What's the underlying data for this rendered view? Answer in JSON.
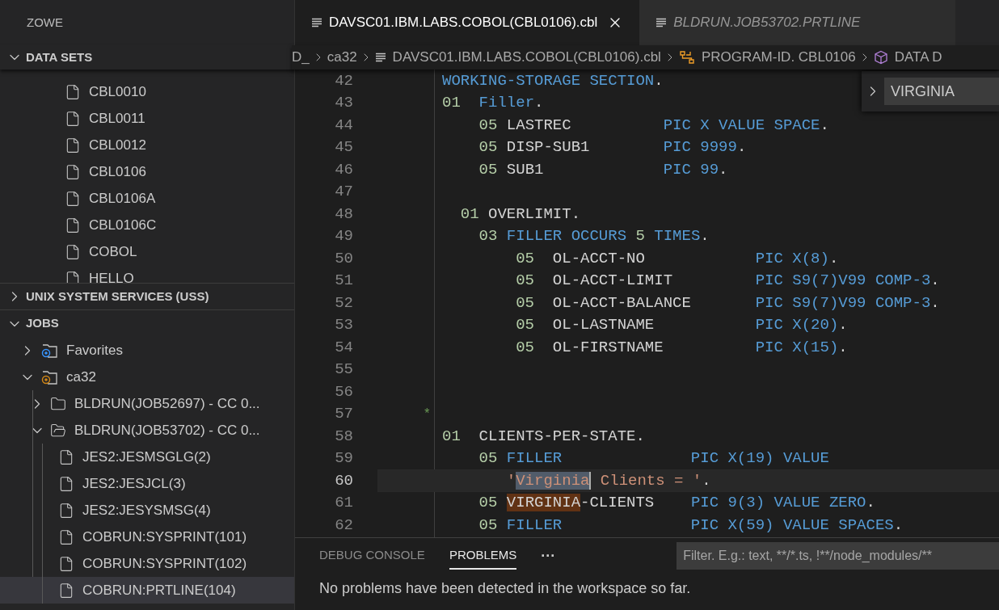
{
  "sidebar": {
    "title": "ZOWE",
    "data_sets": {
      "label": "DATA SETS",
      "expanded": true,
      "members": [
        {
          "label": "CBL0010",
          "selected": false
        },
        {
          "label": "CBL0011",
          "selected": false
        },
        {
          "label": "CBL0012",
          "selected": false
        },
        {
          "label": "CBL0106",
          "selected": false
        },
        {
          "label": "CBL0106A",
          "selected": false
        },
        {
          "label": "CBL0106C",
          "selected": false
        },
        {
          "label": "COBOL",
          "selected": false
        },
        {
          "label": "HELLO",
          "selected": false
        }
      ]
    },
    "uss": {
      "label": "UNIX SYSTEM SERVICES (USS)",
      "expanded": false
    },
    "jobs": {
      "label": "JOBS",
      "expanded": true,
      "items": [
        {
          "kind": "favorites",
          "label": "Favorites",
          "expanded": false,
          "selected": false
        },
        {
          "kind": "profile",
          "label": "ca32",
          "expanded": true,
          "selected": false,
          "children": [
            {
              "kind": "folder",
              "label": "BLDRUN(JOB52697) - CC 0...",
              "expanded": false,
              "selected": false
            },
            {
              "kind": "folder",
              "label": "BLDRUN(JOB53702) - CC 0...",
              "expanded": true,
              "selected": false,
              "children": [
                {
                  "kind": "file",
                  "label": "JES2:JESMSGLG(2)",
                  "selected": false
                },
                {
                  "kind": "file",
                  "label": "JES2:JESJCL(3)",
                  "selected": false
                },
                {
                  "kind": "file",
                  "label": "JES2:JESYSMSG(4)",
                  "selected": false
                },
                {
                  "kind": "file",
                  "label": "COBRUN:SYSPRINT(101)",
                  "selected": false
                },
                {
                  "kind": "file",
                  "label": "COBRUN:SYSPRINT(102)",
                  "selected": false
                },
                {
                  "kind": "file",
                  "label": "COBRUN:PRTLINE(104)",
                  "selected": true
                }
              ]
            }
          ]
        }
      ]
    }
  },
  "tabs": [
    {
      "label": "DAVSC01.IBM.LABS.COBOL(CBL0106).cbl",
      "selected": true,
      "preview": false
    },
    {
      "label": "BLDRUN.JOB53702.PRTLINE",
      "selected": false,
      "preview": true
    }
  ],
  "breadcrumb": [
    {
      "kind": "text",
      "label": "D_"
    },
    {
      "kind": "text",
      "label": "ca32"
    },
    {
      "kind": "file",
      "label": "DAVSC01.IBM.LABS.COBOL(CBL0106).cbl"
    },
    {
      "kind": "struct",
      "label": "PROGRAM-ID. CBL0106"
    },
    {
      "kind": "cube",
      "label": "DATA D"
    }
  ],
  "find_widget": {
    "expanded": false,
    "value": "VIRGINIA"
  },
  "code_lines": [
    {
      "number": "42",
      "current": false,
      "segments": [
        {
          "kind": "keyword",
          "text": "WORKING-STORAGE SECTION"
        },
        {
          "kind": "plain",
          "text": "."
        }
      ]
    },
    {
      "number": "43",
      "current": false,
      "segments": [
        {
          "kind": "number",
          "text": "01"
        },
        {
          "kind": "keyword",
          "text": "  Filler"
        },
        {
          "kind": "plain",
          "text": "."
        }
      ]
    },
    {
      "number": "44",
      "current": false,
      "segments": [
        {
          "kind": "number",
          "text": "    05"
        },
        {
          "kind": "plain",
          "text": " LASTREC          "
        },
        {
          "kind": "keyword",
          "text": "PIC X VALUE SPACE"
        },
        {
          "kind": "plain",
          "text": "."
        }
      ]
    },
    {
      "number": "45",
      "current": false,
      "segments": [
        {
          "kind": "number",
          "text": "    05"
        },
        {
          "kind": "plain",
          "text": " DISP-SUB1        "
        },
        {
          "kind": "keyword",
          "text": "PIC 9999"
        },
        {
          "kind": "plain",
          "text": "."
        }
      ]
    },
    {
      "number": "46",
      "current": false,
      "segments": [
        {
          "kind": "number",
          "text": "    05"
        },
        {
          "kind": "plain",
          "text": " SUB1             "
        },
        {
          "kind": "keyword",
          "text": "PIC 99"
        },
        {
          "kind": "plain",
          "text": "."
        }
      ]
    },
    {
      "number": "47",
      "current": false
    },
    {
      "number": "48",
      "current": false,
      "segments": [
        {
          "kind": "number",
          "text": "  01"
        },
        {
          "kind": "plain",
          "text": " OVERLIMIT."
        }
      ]
    },
    {
      "number": "49",
      "current": false,
      "segments": [
        {
          "kind": "number",
          "text": "    03"
        },
        {
          "kind": "keyword",
          "text": " FILLER OCCURS"
        },
        {
          "kind": "number",
          "text": " 5"
        },
        {
          "kind": "keyword",
          "text": " TIMES"
        },
        {
          "kind": "plain",
          "text": "."
        }
      ]
    },
    {
      "number": "50",
      "current": false,
      "segments": [
        {
          "kind": "number",
          "text": "        05"
        },
        {
          "kind": "plain",
          "text": "  OL-ACCT-NO            "
        },
        {
          "kind": "keyword",
          "text": "PIC X(8)"
        },
        {
          "kind": "plain",
          "text": "."
        }
      ]
    },
    {
      "number": "51",
      "current": false,
      "segments": [
        {
          "kind": "number",
          "text": "        05"
        },
        {
          "kind": "plain",
          "text": "  OL-ACCT-LIMIT         "
        },
        {
          "kind": "keyword",
          "text": "PIC S9(7)V99 COMP-3"
        },
        {
          "kind": "plain",
          "text": "."
        }
      ]
    },
    {
      "number": "52",
      "current": false,
      "segments": [
        {
          "kind": "number",
          "text": "        05"
        },
        {
          "kind": "plain",
          "text": "  OL-ACCT-BALANCE       "
        },
        {
          "kind": "keyword",
          "text": "PIC S9(7)V99 COMP-3"
        },
        {
          "kind": "plain",
          "text": "."
        }
      ]
    },
    {
      "number": "53",
      "current": false,
      "segments": [
        {
          "kind": "number",
          "text": "        05"
        },
        {
          "kind": "plain",
          "text": "  OL-LASTNAME           "
        },
        {
          "kind": "keyword",
          "text": "PIC X(20)"
        },
        {
          "kind": "plain",
          "text": "."
        }
      ]
    },
    {
      "number": "54",
      "current": false,
      "segments": [
        {
          "kind": "number",
          "text": "        05"
        },
        {
          "kind": "plain",
          "text": "  OL-FIRSTNAME          "
        },
        {
          "kind": "keyword",
          "text": "PIC X(15)"
        },
        {
          "kind": "plain",
          "text": "."
        }
      ]
    },
    {
      "number": "55",
      "current": false
    },
    {
      "number": "56",
      "current": false
    },
    {
      "number": "57",
      "current": false,
      "gutter_mark": "*"
    },
    {
      "number": "58",
      "current": false,
      "segments": [
        {
          "kind": "number",
          "text": "01"
        },
        {
          "kind": "plain",
          "text": "  CLIENTS-PER-STATE."
        }
      ]
    },
    {
      "number": "59",
      "current": false,
      "segments": [
        {
          "kind": "number",
          "text": "    05"
        },
        {
          "kind": "keyword",
          "text": " FILLER              PIC X(19) VALUE"
        }
      ]
    },
    {
      "number": "60",
      "current": true,
      "segments": [
        {
          "kind": "string",
          "text": "       '"
        },
        {
          "kind": "string",
          "text": "Virginia",
          "selected": true
        },
        {
          "kind": "string",
          "text": " Clients = '"
        },
        {
          "kind": "plain",
          "text": "."
        }
      ]
    },
    {
      "number": "61",
      "current": false,
      "segments": [
        {
          "kind": "number",
          "text": "    05 "
        },
        {
          "kind": "plain",
          "text": "VIRGINIA",
          "match": true
        },
        {
          "kind": "plain",
          "text": "-CLIENTS    "
        },
        {
          "kind": "keyword",
          "text": "PIC 9(3) VALUE ZERO"
        },
        {
          "kind": "plain",
          "text": "."
        }
      ]
    },
    {
      "number": "62",
      "current": false,
      "segments": [
        {
          "kind": "number",
          "text": "    05"
        },
        {
          "kind": "keyword",
          "text": " FILLER              PIC X(59) VALUE SPACES"
        },
        {
          "kind": "plain",
          "text": "."
        }
      ]
    }
  ],
  "panel": {
    "tabs": [
      {
        "label": "DEBUG CONSOLE",
        "selected": false
      },
      {
        "label": "PROBLEMS",
        "selected": true
      }
    ],
    "more": "···",
    "filter": {
      "placeholder": "Filter. E.g.: text, **/*.ts, !**/node_modules/**"
    },
    "message": "No problems have been detected in the workspace so far."
  }
}
